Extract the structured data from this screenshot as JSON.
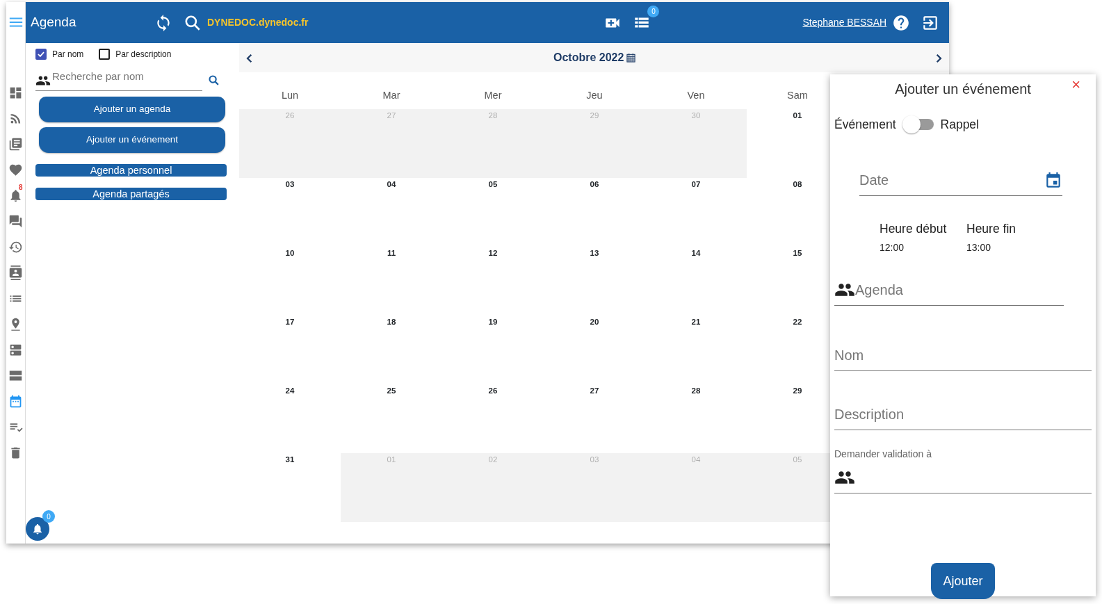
{
  "sidebar": {
    "items": [
      {
        "selected": false
      },
      {
        "selected": false
      },
      {
        "selected": false
      },
      {
        "selected": false
      },
      {
        "selected": false,
        "badge": "8"
      },
      {
        "selected": false
      },
      {
        "selected": false
      },
      {
        "selected": false
      },
      {
        "selected": false
      },
      {
        "selected": false
      },
      {
        "selected": false
      },
      {
        "selected": false
      },
      {
        "selected": true
      },
      {
        "selected": false
      },
      {
        "selected": false
      }
    ]
  },
  "header": {
    "title": "Agenda",
    "domain": "DYNEDOC.dynedoc.fr",
    "tasks_badge": "0",
    "user": "Stephane BESSAH"
  },
  "filters": [
    {
      "label": "Par nom",
      "checked": true
    },
    {
      "label": "Par description",
      "checked": false
    }
  ],
  "search": {
    "placeholder": "Recherche par nom"
  },
  "actions": [
    "Ajouter un agenda",
    "Ajouter un événement"
  ],
  "sections": [
    "Agenda personnel",
    "Agenda partagés"
  ],
  "notifications_badge": "0",
  "calendar": {
    "month": "Octobre 2022",
    "weekdays": [
      "Lun",
      "Mar",
      "Mer",
      "Jeu",
      "Ven",
      "Sam"
    ],
    "weeks": [
      [
        {
          "day": "26",
          "other_month": true
        },
        {
          "day": "27",
          "other_month": true
        },
        {
          "day": "28",
          "other_month": true
        },
        {
          "day": "29",
          "other_month": true
        },
        {
          "day": "30",
          "other_month": true
        },
        {
          "day": "01",
          "other_month": false
        }
      ],
      [
        {
          "day": "03",
          "other_month": false
        },
        {
          "day": "04",
          "other_month": false
        },
        {
          "day": "05",
          "other_month": false
        },
        {
          "day": "06",
          "other_month": false
        },
        {
          "day": "07",
          "other_month": false
        },
        {
          "day": "08",
          "other_month": false
        }
      ],
      [
        {
          "day": "10",
          "other_month": false
        },
        {
          "day": "11",
          "other_month": false
        },
        {
          "day": "12",
          "other_month": false
        },
        {
          "day": "13",
          "other_month": false
        },
        {
          "day": "14",
          "other_month": false
        },
        {
          "day": "15",
          "other_month": false
        }
      ],
      [
        {
          "day": "17",
          "other_month": false
        },
        {
          "day": "18",
          "other_month": false
        },
        {
          "day": "19",
          "other_month": false
        },
        {
          "day": "20",
          "other_month": false
        },
        {
          "day": "21",
          "other_month": false
        },
        {
          "day": "22",
          "other_month": false
        }
      ],
      [
        {
          "day": "24",
          "other_month": false
        },
        {
          "day": "25",
          "other_month": false
        },
        {
          "day": "26",
          "other_month": false
        },
        {
          "day": "27",
          "other_month": false
        },
        {
          "day": "28",
          "other_month": false
        },
        {
          "day": "29",
          "other_month": false
        }
      ],
      [
        {
          "day": "31",
          "other_month": false
        },
        {
          "day": "01",
          "other_month": true
        },
        {
          "day": "02",
          "other_month": true
        },
        {
          "day": "03",
          "other_month": true
        },
        {
          "day": "04",
          "other_month": true
        },
        {
          "day": "05",
          "other_month": true
        }
      ]
    ]
  },
  "dialog": {
    "title": "Ajouter un événement",
    "close": "×",
    "toggle": {
      "left_label": "Événement",
      "right_label": "Rappel",
      "on": false
    },
    "date": {
      "placeholder": "Date"
    },
    "times": [
      {
        "label": "Heure début",
        "value": "12:00"
      },
      {
        "label": "Heure fin",
        "value": "13:00"
      }
    ],
    "agenda": {
      "placeholder": "Agenda"
    },
    "name": {
      "placeholder": "Nom"
    },
    "description": {
      "placeholder": "Description"
    },
    "validation_label": "Demander validation à",
    "submit": "Ajouter"
  }
}
